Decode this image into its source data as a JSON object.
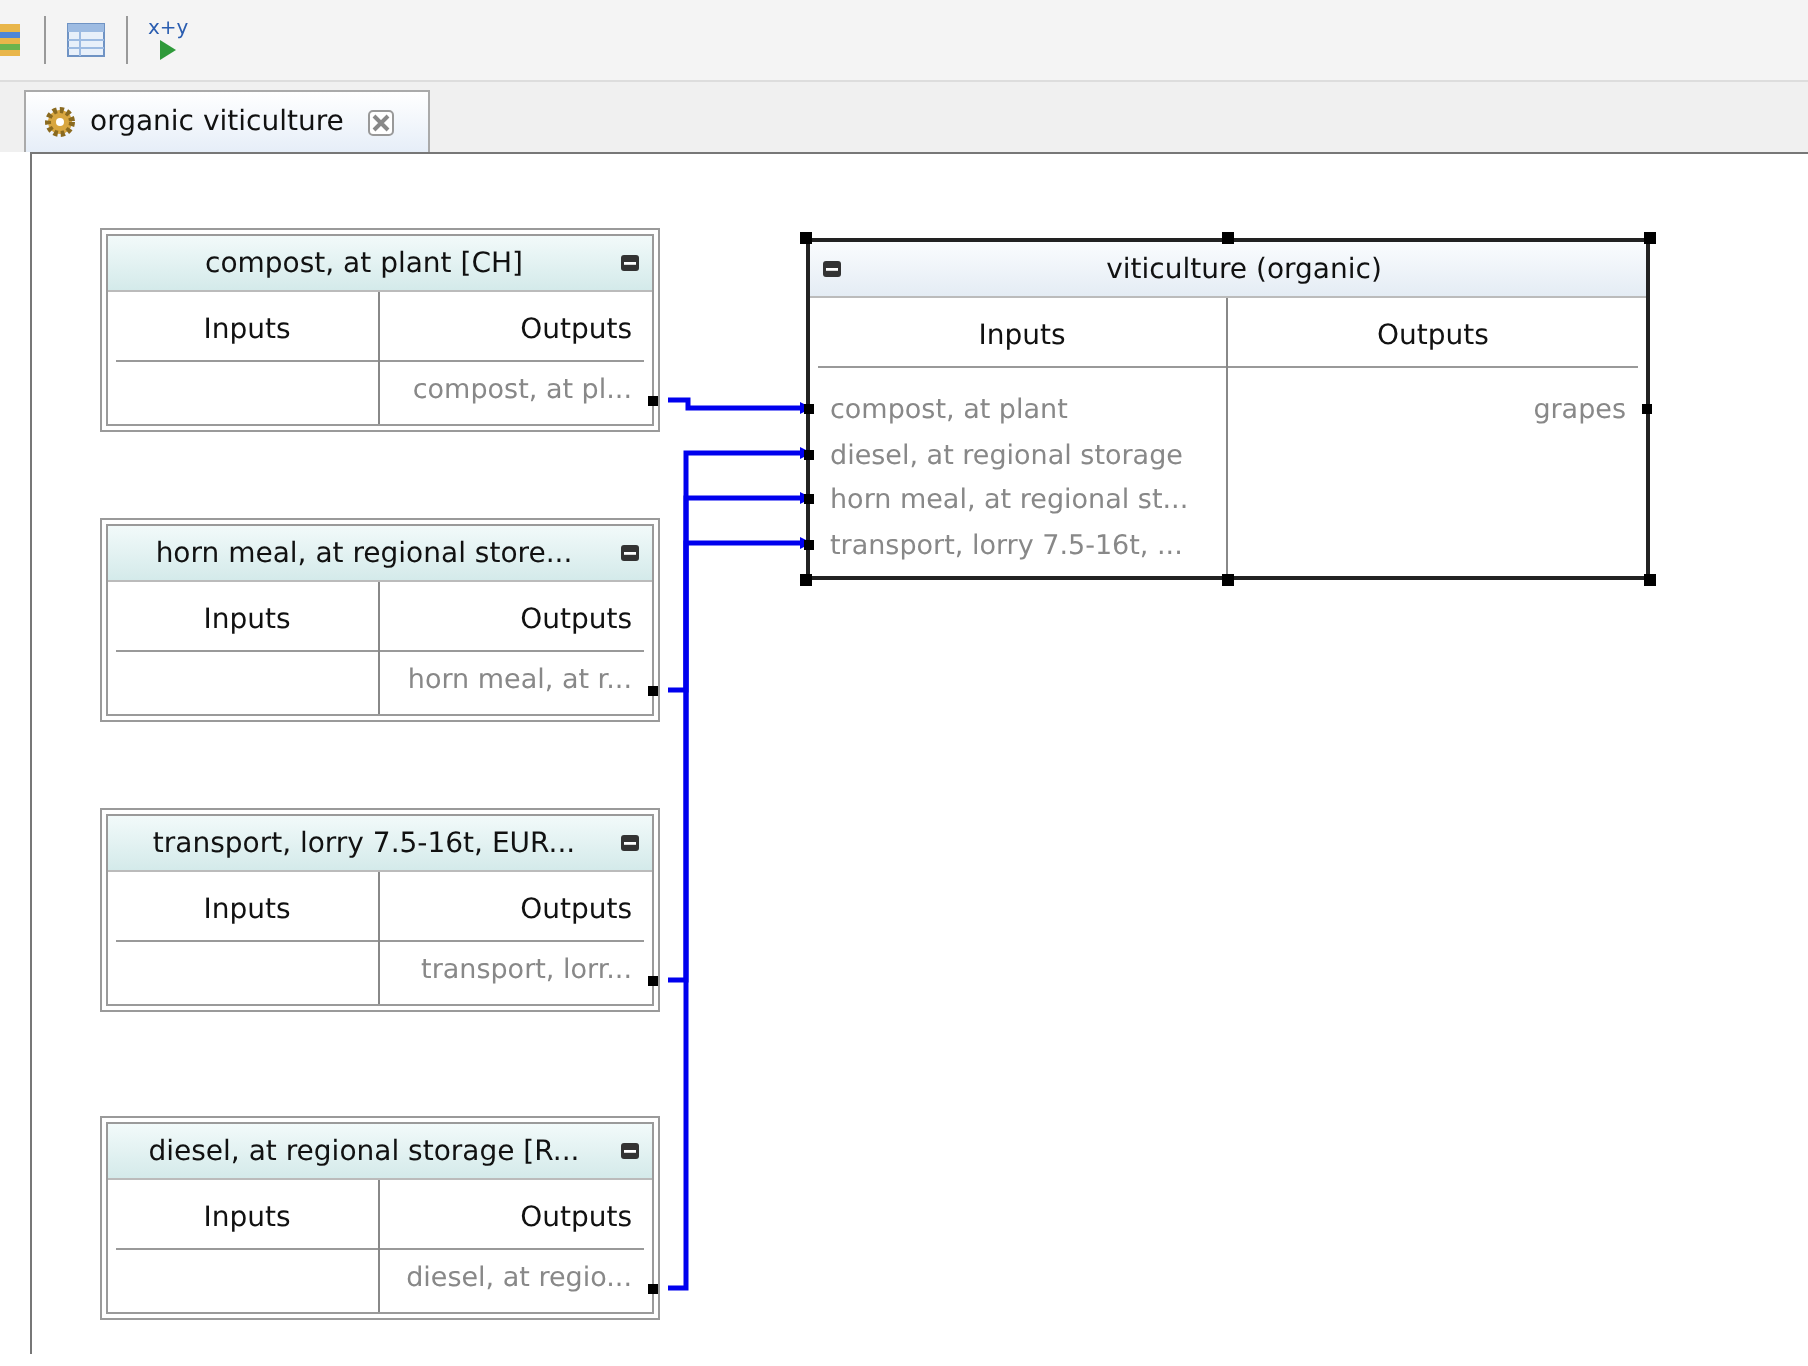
{
  "toolbar": {
    "formula_button": "x+y"
  },
  "tab": {
    "label": "organic viticulture",
    "selected": true
  },
  "nodes": [
    {
      "title": "compost, at plant [CH]",
      "inputs_header": "Inputs",
      "outputs_header": "Outputs",
      "outputs": [
        "compost, at pl..."
      ],
      "selected": false
    },
    {
      "title": "horn meal, at regional store...",
      "inputs_header": "Inputs",
      "outputs_header": "Outputs",
      "outputs": [
        "horn meal, at r..."
      ],
      "selected": false
    },
    {
      "title": "transport, lorry 7.5-16t, EUR...",
      "inputs_header": "Inputs",
      "outputs_header": "Outputs",
      "outputs": [
        "transport, lorr..."
      ],
      "selected": false
    },
    {
      "title": "diesel, at regional storage [R...",
      "inputs_header": "Inputs",
      "outputs_header": "Outputs",
      "outputs": [
        "diesel, at regio..."
      ],
      "selected": false
    },
    {
      "title": "viticulture (organic)",
      "inputs_header": "Inputs",
      "outputs_header": "Outputs",
      "inputs": [
        "compost, at plant",
        "diesel, at regional storage",
        "horn meal, at regional st...",
        "transport, lorry 7.5-16t, ..."
      ],
      "outputs": [
        "grapes"
      ],
      "selected": true
    }
  ]
}
